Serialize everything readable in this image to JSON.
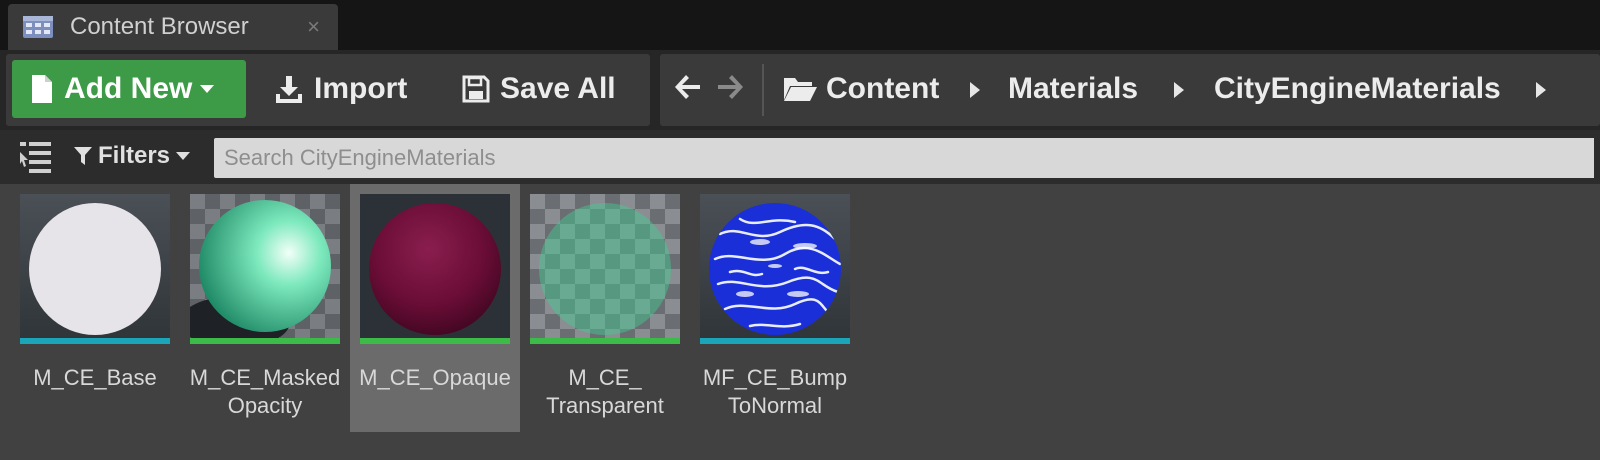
{
  "tab": {
    "title": "Content Browser",
    "close_glyph": "×",
    "icon": "content-browser-icon"
  },
  "toolbar": {
    "add_new_label": "Add New",
    "import_label": "Import",
    "save_all_label": "Save All"
  },
  "breadcrumb": {
    "items": [
      "Content",
      "Materials",
      "CityEngineMaterials"
    ]
  },
  "filterbar": {
    "filters_label": "Filters",
    "search_placeholder": "Search CityEngineMaterials"
  },
  "assets": [
    {
      "name": "M_CE_Base",
      "type_color": "#1aa6b8",
      "selected": false
    },
    {
      "name": "M_CE_Masked\nOpacity",
      "type_color": "#3dbb48",
      "selected": false
    },
    {
      "name": "M_CE_Opaque",
      "type_color": "#3dbb48",
      "selected": true
    },
    {
      "name": "M_CE_\nTransparent",
      "type_color": "#3dbb48",
      "selected": false
    },
    {
      "name": "MF_CE_Bump\nToNormal",
      "type_color": "#1aa6b8",
      "selected": false
    }
  ],
  "colors": {
    "add_new_green": "#3d9a46",
    "material_bar": "#3dbb48",
    "function_bar": "#1aa6b8",
    "selection": "#6b6b6b"
  }
}
